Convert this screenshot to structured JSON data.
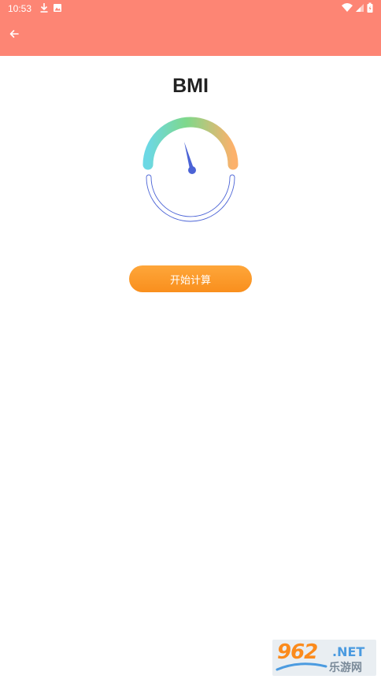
{
  "status_bar": {
    "time": "10:53",
    "left_icons": [
      "download-icon",
      "photo-icon"
    ],
    "right_icons": [
      "wifi-icon",
      "signal-icon",
      "battery-icon"
    ]
  },
  "toolbar": {
    "back_icon": "arrow-left-icon",
    "background_color": "#fd8574"
  },
  "page": {
    "title": "BMI"
  },
  "gauge": {
    "arc_colors": [
      "#6cd8e4",
      "#7ed88b",
      "#fcb16b"
    ],
    "needle_color": "#4b63d6"
  },
  "actions": {
    "start_label": "开始计算"
  },
  "watermark": {
    "number_text": "962",
    "domain_text": ".NET",
    "site_text": "乐游网"
  }
}
